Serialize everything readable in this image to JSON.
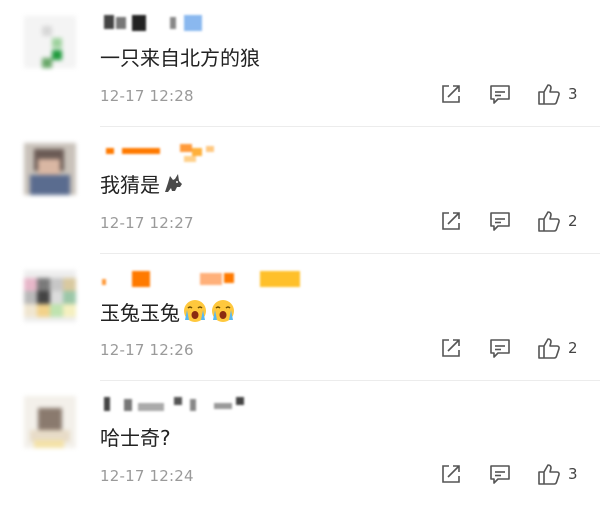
{
  "comments": [
    {
      "nickname": "",
      "text": "一只来自北方的狼",
      "emoji": [],
      "time": "12-17 12:28",
      "likes": "3"
    },
    {
      "nickname": "",
      "text": "我猜是",
      "emoji": [
        "wolf-emoji"
      ],
      "time": "12-17 12:27",
      "likes": "2"
    },
    {
      "nickname": "",
      "text": "玉兔玉兔",
      "emoji": [
        "crying-face-emoji",
        "crying-face-emoji"
      ],
      "time": "12-17 12:26",
      "likes": "2"
    },
    {
      "nickname": "",
      "text": "哈士奇?",
      "emoji": [],
      "time": "12-17 12:24",
      "likes": "3"
    }
  ],
  "icons": {
    "share": "share-icon",
    "reply": "comment-icon",
    "like": "thumbs-up-icon"
  },
  "colors": {
    "text": "#222222",
    "meta": "#9a9a9a",
    "icon": "#555555",
    "blurOrange": "#ff7a00",
    "blurYellow": "#ffc02a"
  }
}
